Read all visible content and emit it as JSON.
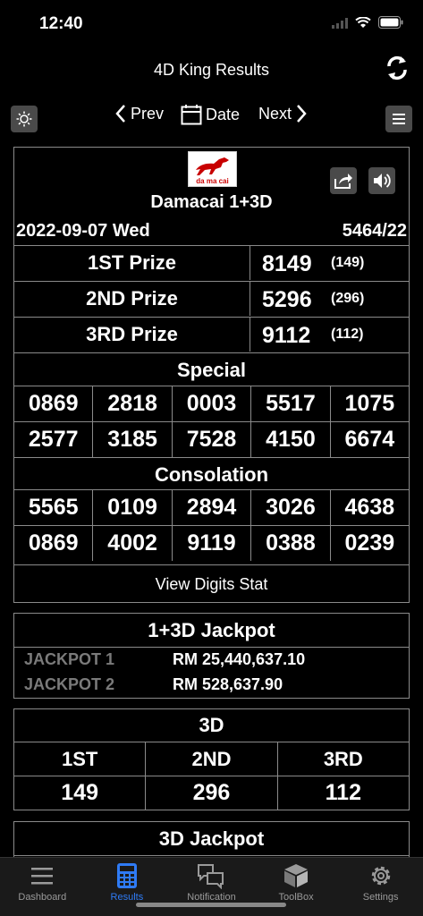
{
  "status": {
    "time": "12:40"
  },
  "nav": {
    "title": "4D King Results",
    "prev_label": "Prev",
    "date_label": "Date",
    "next_label": "Next"
  },
  "result": {
    "logo_text": "da ma cai",
    "operator": "Damacai 1+3D",
    "date": "2022-09-07 Wed",
    "draw_no": "5464/22",
    "prizes": [
      {
        "label": "1ST Prize",
        "number": "8149",
        "sub": "(149)"
      },
      {
        "label": "2ND Prize",
        "number": "5296",
        "sub": "(296)"
      },
      {
        "label": "3RD Prize",
        "number": "9112",
        "sub": "(112)"
      }
    ],
    "special_title": "Special",
    "special": [
      [
        "0869",
        "2818",
        "0003",
        "5517",
        "1075"
      ],
      [
        "2577",
        "3185",
        "7528",
        "4150",
        "6674"
      ]
    ],
    "consolation_title": "Consolation",
    "consolation": [
      [
        "5565",
        "0109",
        "2894",
        "3026",
        "4638"
      ],
      [
        "0869",
        "4002",
        "9119",
        "0388",
        "0239"
      ]
    ],
    "view_stat_label": "View Digits Stat"
  },
  "jackpot": {
    "title": "1+3D Jackpot",
    "rows": [
      {
        "label": "JACKPOT 1",
        "value": "RM 25,440,637.10"
      },
      {
        "label": "JACKPOT 2",
        "value": "RM 528,637.90"
      }
    ]
  },
  "d3": {
    "title": "3D",
    "headers": [
      "1ST",
      "2ND",
      "3RD"
    ],
    "values": [
      "149",
      "296",
      "112"
    ]
  },
  "d3_jackpot": {
    "title": "3D Jackpot"
  },
  "tabs": [
    {
      "label": "Dashboard",
      "icon": "hamburger-icon"
    },
    {
      "label": "Results",
      "icon": "calculator-icon"
    },
    {
      "label": "Notification",
      "icon": "chat-bubbles-icon"
    },
    {
      "label": "ToolBox",
      "icon": "box-icon"
    },
    {
      "label": "Settings",
      "icon": "gear-icon"
    }
  ],
  "colors": {
    "accent": "#2f7bf5",
    "border": "#8a8a8a",
    "muted_label": "#7a7a7a",
    "button_bg": "#4a4a4a"
  }
}
